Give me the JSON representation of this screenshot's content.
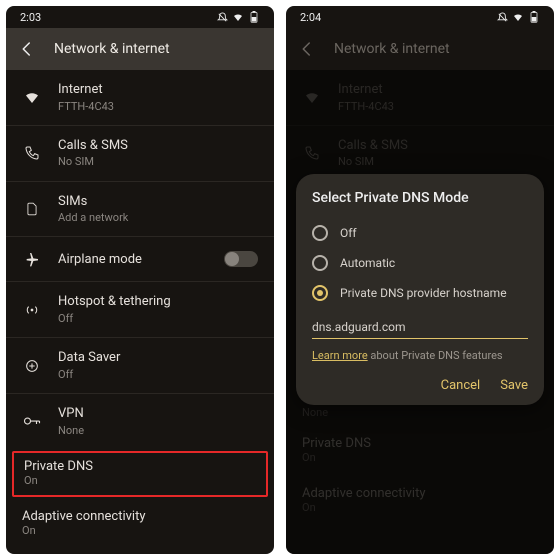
{
  "left": {
    "time": "2:03",
    "page_title": "Network & internet",
    "rows": [
      {
        "title": "Internet",
        "sub": "FTTH-4C43"
      },
      {
        "title": "Calls & SMS",
        "sub": "No SIM"
      },
      {
        "title": "SIMs",
        "sub": "Add a network"
      },
      {
        "title": "Airplane mode",
        "sub": ""
      },
      {
        "title": "Hotspot & tethering",
        "sub": "Off"
      },
      {
        "title": "Data Saver",
        "sub": "Off"
      },
      {
        "title": "VPN",
        "sub": "None"
      }
    ],
    "highlight": {
      "title": "Private DNS",
      "sub": "On"
    },
    "adaptive": {
      "title": "Adaptive connectivity",
      "sub": "On"
    }
  },
  "right": {
    "time": "2:04",
    "page_title": "Network & internet",
    "row0": {
      "title": "Internet",
      "sub": "FTTH-4C43"
    },
    "row1": {
      "title": "Calls & SMS",
      "sub": "No SIM"
    },
    "vpn_sub": "None",
    "privdns": {
      "title": "Private DNS",
      "sub": "On"
    },
    "adaptive": {
      "title": "Adaptive connectivity",
      "sub": "On"
    },
    "dialog": {
      "title": "Select Private DNS Mode",
      "opt_off": "Off",
      "opt_auto": "Automatic",
      "opt_host": "Private DNS provider hostname",
      "input_value": "dns.adguard.com",
      "learn_link": "Learn more",
      "learn_rest": " about Private DNS features",
      "cancel": "Cancel",
      "save": "Save"
    }
  }
}
